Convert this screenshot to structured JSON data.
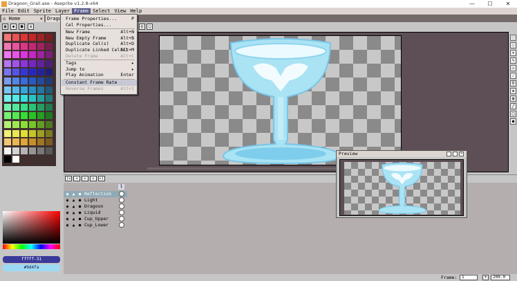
{
  "window": {
    "title": "Dragoon_Grail.ase - Aseprite v1.2.8-x64",
    "buttons": [
      "—",
      "☐",
      "✕"
    ]
  },
  "menubar": [
    "File",
    "Edit",
    "Sprite",
    "Layer",
    "Frame",
    "Select",
    "View",
    "Help"
  ],
  "tabs": {
    "home": "Home",
    "sprite": "Drago"
  },
  "frame_menu": {
    "items": [
      {
        "label": "Frame Properties...",
        "shortcut": "P"
      },
      {
        "label": "Cel Properties...",
        "shortcut": ""
      },
      {
        "label": "New Frame",
        "shortcut": "Alt+N"
      },
      {
        "label": "New Empty Frame",
        "shortcut": "Alt+B"
      },
      {
        "label": "Duplicate Cel(s)",
        "shortcut": "Alt+D"
      },
      {
        "label": "Duplicate Linked Cel(s)",
        "shortcut": "Alt+M"
      },
      {
        "label": "Delete Frame",
        "shortcut": "Alt+C"
      },
      {
        "label": "Tags",
        "shortcut": "▸"
      },
      {
        "label": "Jump to",
        "shortcut": "▸"
      },
      {
        "label": "Play Animation",
        "shortcut": "Enter"
      },
      {
        "label": "Constant Frame Rate",
        "shortcut": ""
      },
      {
        "label": "Reverse Frames",
        "shortcut": "Alt+I"
      }
    ]
  },
  "layers": [
    "Reflection",
    "Light",
    "Dragoon",
    "Liquid",
    "Cup_Upper",
    "Cup_Lower"
  ],
  "frame_number": "1",
  "color_fg": "fffff-31",
  "color_bg": "#9d4fa",
  "preview": {
    "title": "Preview"
  },
  "status": {
    "frame_label": "Frame:",
    "frame_value": "1",
    "zoom": "200.0"
  },
  "colors": {
    "accent": "#5c5c8c",
    "editor_bg": "#5d4f55",
    "glass": "#a9e3f4"
  }
}
